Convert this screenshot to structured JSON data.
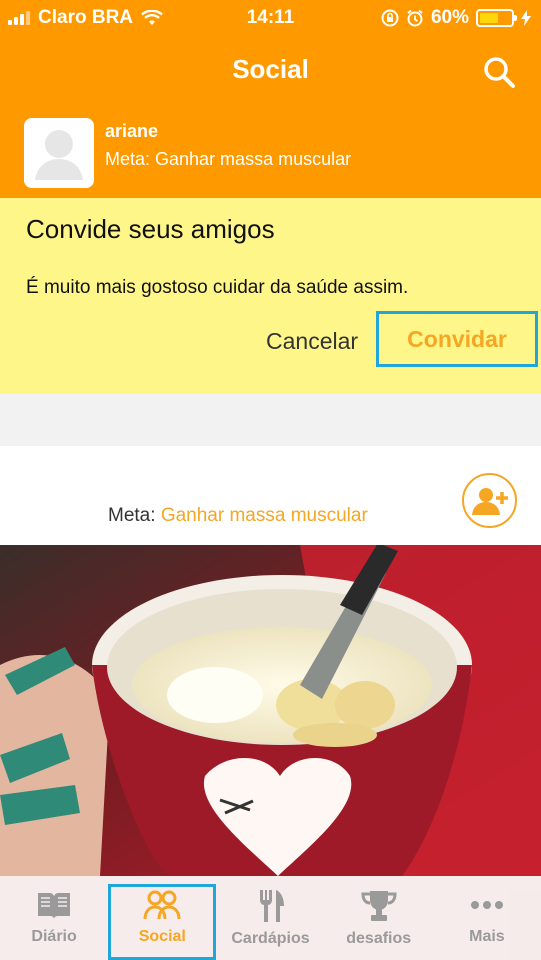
{
  "status_bar": {
    "carrier": "Claro BRA",
    "time": "14:11",
    "battery": "60%",
    "battery_level": 0.6
  },
  "header": {
    "title": "Social",
    "search_icon": "search-icon"
  },
  "profile": {
    "name": "ariane",
    "goal": "Meta: Ganhar massa muscular"
  },
  "invite_card": {
    "title": "Convide seus amigos",
    "message": "É muito mais gostoso cuidar da saúde assim.",
    "cancel_label": "Cancelar",
    "invite_label": "Convidar"
  },
  "post": {
    "meta_label": "Meta:",
    "meta_value": "Ganhar massa muscular",
    "add_friend_icon": "add-friend-icon"
  },
  "tabs": [
    {
      "label": "Diário",
      "icon": "book-icon"
    },
    {
      "label": "Social",
      "icon": "people-icon"
    },
    {
      "label": "Cardápios",
      "icon": "fork-knife-icon"
    },
    {
      "label": "desafios",
      "icon": "trophy-icon"
    },
    {
      "label": "Mais",
      "icon": "more-icon"
    }
  ],
  "colors": {
    "brand": "#FF9900",
    "accent": "#F5A623",
    "invite_bg": "#FFF68A",
    "highlight": "#1EA7D8"
  }
}
